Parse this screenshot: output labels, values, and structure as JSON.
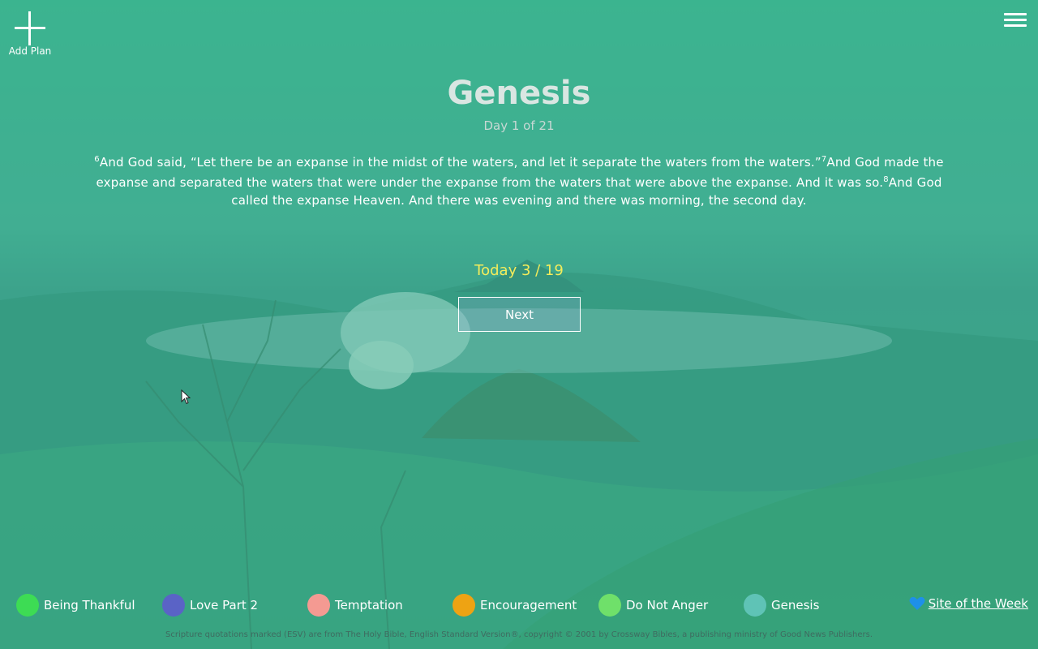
{
  "header": {
    "add_plan_label": "Add Plan",
    "add_icon": "plus-icon",
    "menu_icon": "hamburger-menu-icon"
  },
  "reading": {
    "title": "Genesis",
    "day_text": "Day 1 of 21",
    "verses": [
      {
        "num": "6",
        "text": "And God said, “Let there be an expanse in the midst of the waters, and let it separate the waters from the waters.”"
      },
      {
        "num": "7",
        "text": "And God made the expanse and separated the waters that were under the expanse from the waters that were above the expanse. And it was so."
      },
      {
        "num": "8",
        "text": "And God called the expanse Heaven. And there was evening and there was morning, the second day."
      }
    ],
    "today_progress": "Today 3 / 19",
    "next_label": "Next"
  },
  "plans": [
    {
      "name": "Being Thankful",
      "color": "#3ddc54"
    },
    {
      "name": "Love Part 2",
      "color": "#5a63c6"
    },
    {
      "name": "Temptation",
      "color": "#f49a92"
    },
    {
      "name": "Encouragement",
      "color": "#eea313"
    },
    {
      "name": "Do Not Anger",
      "color": "#6fe06a"
    },
    {
      "name": "Genesis",
      "color": "#5fc3b6"
    }
  ],
  "site_of_week": {
    "label": "Site of the Week",
    "icon": "heart-icon",
    "color": "#1e90e8"
  },
  "footer": {
    "copyright": "Scripture quotations marked (ESV) are from The Holy Bible, English Standard Version®, copyright © 2001 by Crossway Bibles, a publishing ministry of Good News Publishers."
  }
}
